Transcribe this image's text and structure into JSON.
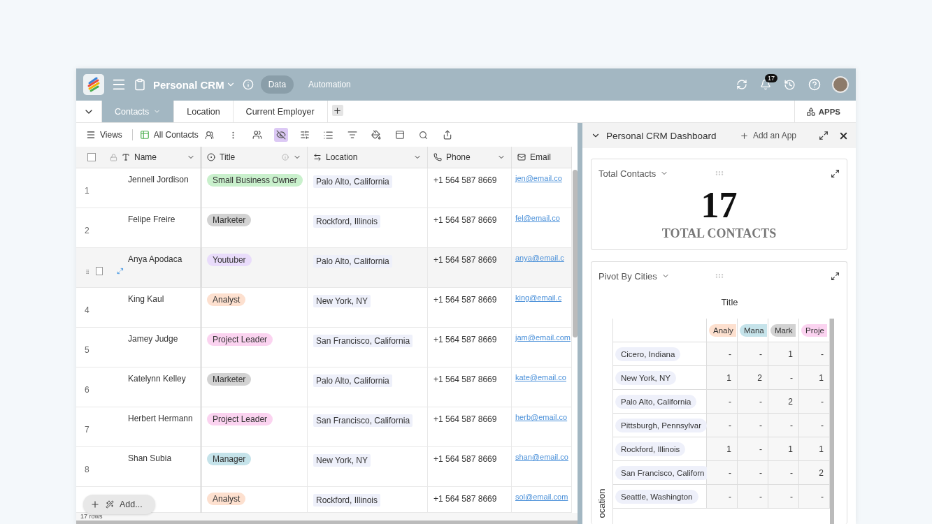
{
  "app": {
    "title": "Personal CRM",
    "modes": [
      {
        "label": "Data",
        "selected": true
      },
      {
        "label": "Automation",
        "selected": false
      }
    ],
    "notification_count": "17"
  },
  "tabs": [
    {
      "label": "Contacts",
      "selected": true
    },
    {
      "label": "Location",
      "selected": false
    },
    {
      "label": "Current Employer",
      "selected": false
    }
  ],
  "apps_button": "APPS",
  "toolbar": {
    "views": "Views",
    "view_name": "All Contacts",
    "hide_fields_active": true
  },
  "table": {
    "columns": [
      {
        "kind": "text",
        "label": "Name"
      },
      {
        "kind": "select",
        "label": "Title"
      },
      {
        "kind": "link",
        "label": "Location"
      },
      {
        "kind": "phone",
        "label": "Phone"
      },
      {
        "kind": "email",
        "label": "Email"
      }
    ],
    "rows": [
      {
        "number": "1",
        "hovered": false,
        "name": "Jennell Jordison",
        "title": {
          "label": "Small Business Owner",
          "color": "#c9f0cc"
        },
        "location": "Palo Alto, California",
        "phone": "+1 564 587 8669",
        "email": "jen@email.co"
      },
      {
        "number": "2",
        "hovered": false,
        "name": "Felipe Freire",
        "title": {
          "label": "Marketer",
          "color": "#d2d2d2"
        },
        "location": "Rockford, Illinois",
        "phone": "+1 564 587 8669",
        "email": "fel@email.co"
      },
      {
        "hovered": true,
        "checked": false,
        "name": "Anya Apodaca",
        "title": {
          "label": "Youtuber",
          "color": "#e9dcfb"
        },
        "location": "Palo Alto, California",
        "phone": "+1 564 587 8669",
        "email": "anya@email.c"
      },
      {
        "number": "4",
        "hovered": false,
        "name": "King Kaul",
        "title": {
          "label": "Analyst",
          "color": "#fde0cf"
        },
        "location": "New York, NY",
        "phone": "+1 564 587 8669",
        "email": "king@email.c"
      },
      {
        "number": "5",
        "hovered": false,
        "name": "Jamey Judge",
        "title": {
          "label": "Project Leader",
          "color": "#fbd3f0"
        },
        "location": "San Francisco, California",
        "phone": "+1 564 587 8669",
        "email": "jam@email.com"
      },
      {
        "number": "6",
        "hovered": false,
        "name": "Katelynn Kelley",
        "title": {
          "label": "Marketer",
          "color": "#d2d2d2"
        },
        "location": "Palo Alto, California",
        "phone": "+1 564 587 8669",
        "email": "kate@email.co"
      },
      {
        "number": "7",
        "hovered": false,
        "name": "Herbert Hermann",
        "title": {
          "label": "Project Leader",
          "color": "#fbd3f0"
        },
        "location": "San Francisco, California",
        "phone": "+1 564 587 8669",
        "email": "herb@email.co"
      },
      {
        "number": "8",
        "hovered": false,
        "name": "Shan Subia",
        "title": {
          "label": "Manager",
          "color": "#c5e3ea"
        },
        "location": "New York, NY",
        "phone": "+1 564 587 8669",
        "email": "shan@email.co"
      }
    ],
    "partial_row": {
      "title": {
        "label": "Analyst",
        "color": "#fde0cf"
      },
      "location": "Rockford, Illinois",
      "phone": "+1 564 587 8669",
      "email": "sol@email.com"
    },
    "add_button": "Add...",
    "row_count": "17 rows",
    "all_selected": false
  },
  "dashboard": {
    "title": "Personal CRM Dashboard",
    "add_app": "Add an App",
    "cards": [
      {
        "kind": "metric",
        "title": "Total Contacts",
        "value": "17",
        "caption": "TOTAL CONTACTS"
      },
      {
        "kind": "pivot",
        "title": "Pivot By Cities",
        "column_heading": "Title",
        "row_heading": "ocation",
        "columns": [
          {
            "label": "Analy",
            "color": "#fde0cf"
          },
          {
            "label": "Mana",
            "color": "#c5e3ea"
          },
          {
            "label": "Mark",
            "color": "#d2d2d2"
          },
          {
            "label": "Proje",
            "color": "#fbd3f0"
          }
        ],
        "rows": [
          {
            "label": "Cicero, Indiana",
            "values": [
              "-",
              "-",
              "1",
              "-"
            ]
          },
          {
            "label": "New York, NY",
            "values": [
              "1",
              "2",
              "-",
              "1"
            ]
          },
          {
            "label": "Palo Alto, California",
            "values": [
              "-",
              "-",
              "2",
              "-"
            ]
          },
          {
            "label": "Pittsburgh, Pennsylvar",
            "values": [
              "-",
              "-",
              "-",
              "-"
            ]
          },
          {
            "label": "Rockford, Illinois",
            "values": [
              "1",
              "-",
              "1",
              "1"
            ]
          },
          {
            "label": "San Francisco, Californ",
            "values": [
              "-",
              "-",
              "-",
              "2"
            ]
          },
          {
            "label": "Seattle, Washington",
            "values": [
              "-",
              "-",
              "-",
              "-"
            ]
          }
        ]
      }
    ]
  }
}
